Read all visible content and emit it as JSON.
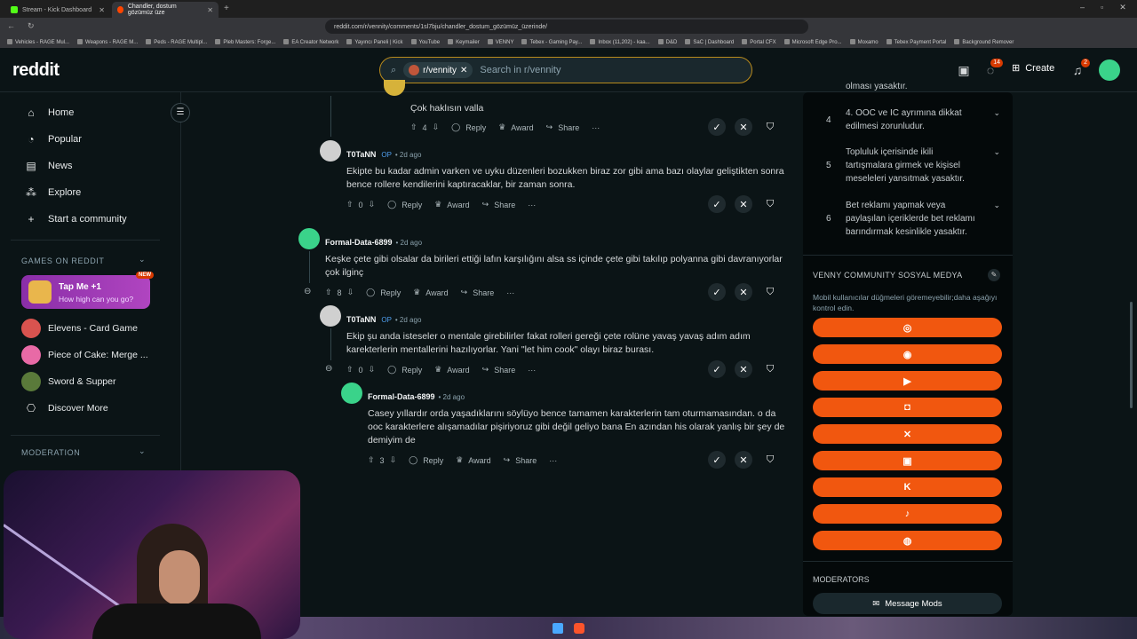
{
  "browser": {
    "tabs": [
      {
        "title": "Stream - Kick Dashboard",
        "active": false
      },
      {
        "title": "Chandler, dostum gözümüz üze",
        "active": true
      }
    ],
    "url": "reddit.com/r/vennity/comments/1sl7bju/chandler_dostum_gözümüz_üzerinde/",
    "bookmarks": [
      "Vehicles - RAGE Mul...",
      "Weapons - RAGE M...",
      "Peds - RAGE Multipl...",
      "Pleb Masters: Forge...",
      "EA Creator Network",
      "Yayıncı Paneli | Kick",
      "YouTube",
      "Keymailer",
      "VENNY",
      "Tebex - Gaming Pay...",
      "Inbox (11,202) - kaa...",
      "D&D",
      "SaC | Dashboard",
      "Portal CFX",
      "Microsoft Edge Pro...",
      "Moxamo",
      "Tebex Payment Portal",
      "Background Remover"
    ]
  },
  "header": {
    "logo": "reddit",
    "search_chip": "r/vennity",
    "search_placeholder": "Search in r/vennity",
    "chat_badge": "14",
    "notif_badge": "2",
    "create_label": "Create"
  },
  "leftnav": {
    "items": [
      {
        "label": "Home",
        "icon": "home-icon"
      },
      {
        "label": "Popular",
        "icon": "popular-icon"
      },
      {
        "label": "News",
        "icon": "news-icon"
      },
      {
        "label": "Explore",
        "icon": "explore-icon"
      },
      {
        "label": "Start a community",
        "icon": "plus-icon"
      }
    ],
    "games_heading": "GAMES ON REDDIT",
    "promo": {
      "title": "Tap Me +1",
      "subtitle": "How high can you go?",
      "badge": "NEW"
    },
    "games": [
      {
        "label": "Elevens - Card Game"
      },
      {
        "label": "Piece of Cake: Merge ..."
      },
      {
        "label": "Sword & Supper"
      },
      {
        "label": "Discover More"
      }
    ],
    "moderation_heading": "MODERATION"
  },
  "comments": [
    {
      "author": "",
      "op": "",
      "time": "",
      "body": "Çok haklısın valla",
      "score": "4"
    },
    {
      "author": "T0TaNN",
      "op": "OP",
      "time": "• 2d ago",
      "body": "Ekipte bu kadar admin varken ve uyku düzenleri bozukken biraz zor gibi ama bazı olaylar geliştikten sonra bence rollere kendilerini kaptıracaklar, bir zaman sonra.",
      "score": "0"
    },
    {
      "author": "Formal-Data-6899",
      "op": "",
      "time": "• 2d ago",
      "body": "Keşke çete gibi olsalar da birileri ettiği lafın karşılığını alsa ss içinde çete gibi takılıp polyanna gibi davranıyorlar çok ilginç",
      "score": "8"
    },
    {
      "author": "T0TaNN",
      "op": "OP",
      "time": "• 2d ago",
      "body": "Ekip şu anda isteseler o mentale girebilirler fakat rolleri gereği çete rolüne yavaş yavaş adım adım karekterlerin mentallerini hazılıyorlar. Yani \"let him cook\" olayı biraz burası.",
      "score": "0"
    },
    {
      "author": "Formal-Data-6899",
      "op": "",
      "time": "• 2d ago",
      "body": "Casey yıllardır orda yaşadıklarını söylüyo bence tamamen karakterlerin tam oturmamasından. o da ooc karakterlere alışamadılar pişiriyoruz gibi değil geliyo bana En azından his olarak yanlış bir şey de demiyim de",
      "score": "3"
    }
  ],
  "actions": {
    "reply": "Reply",
    "award": "Award",
    "share": "Share",
    "more": "···"
  },
  "sidebar": {
    "rule_partial": "olması yasaktır.",
    "rules": [
      {
        "num": "4",
        "text": "4. OOC ve IC ayrımına dikkat edilmesi zorunludur."
      },
      {
        "num": "5",
        "text": "Topluluk içerisinde ikili tartışmalara girmek ve kişisel meseleleri yansıtmak yasaktır."
      },
      {
        "num": "6",
        "text": "Bet reklamı yapmak veya paylaşılan içeriklerde bet reklamı barındırmak kesinlikle yasaktır."
      }
    ],
    "social_heading": "VENNY COMMUNITY SOSYAL MEDYA",
    "social_note": "Mobil kullanıcılar düğmeleri göremeyebilir;daha aşağıyı kontrol edin.",
    "social_buttons": [
      {
        "icon": "globe-icon",
        "glyph": "◎"
      },
      {
        "icon": "discord-icon",
        "glyph": "◉"
      },
      {
        "icon": "youtube-icon",
        "glyph": "▶"
      },
      {
        "icon": "instagram-icon",
        "glyph": "◘"
      },
      {
        "icon": "x-icon",
        "glyph": "✕"
      },
      {
        "icon": "twitch-icon",
        "glyph": "▣"
      },
      {
        "icon": "kick-icon",
        "glyph": "K"
      },
      {
        "icon": "tiktok-icon",
        "glyph": "♪"
      },
      {
        "icon": "steam-icon",
        "glyph": "◍"
      }
    ],
    "moderators_heading": "MODERATORS",
    "message_mods": "Message Mods"
  }
}
